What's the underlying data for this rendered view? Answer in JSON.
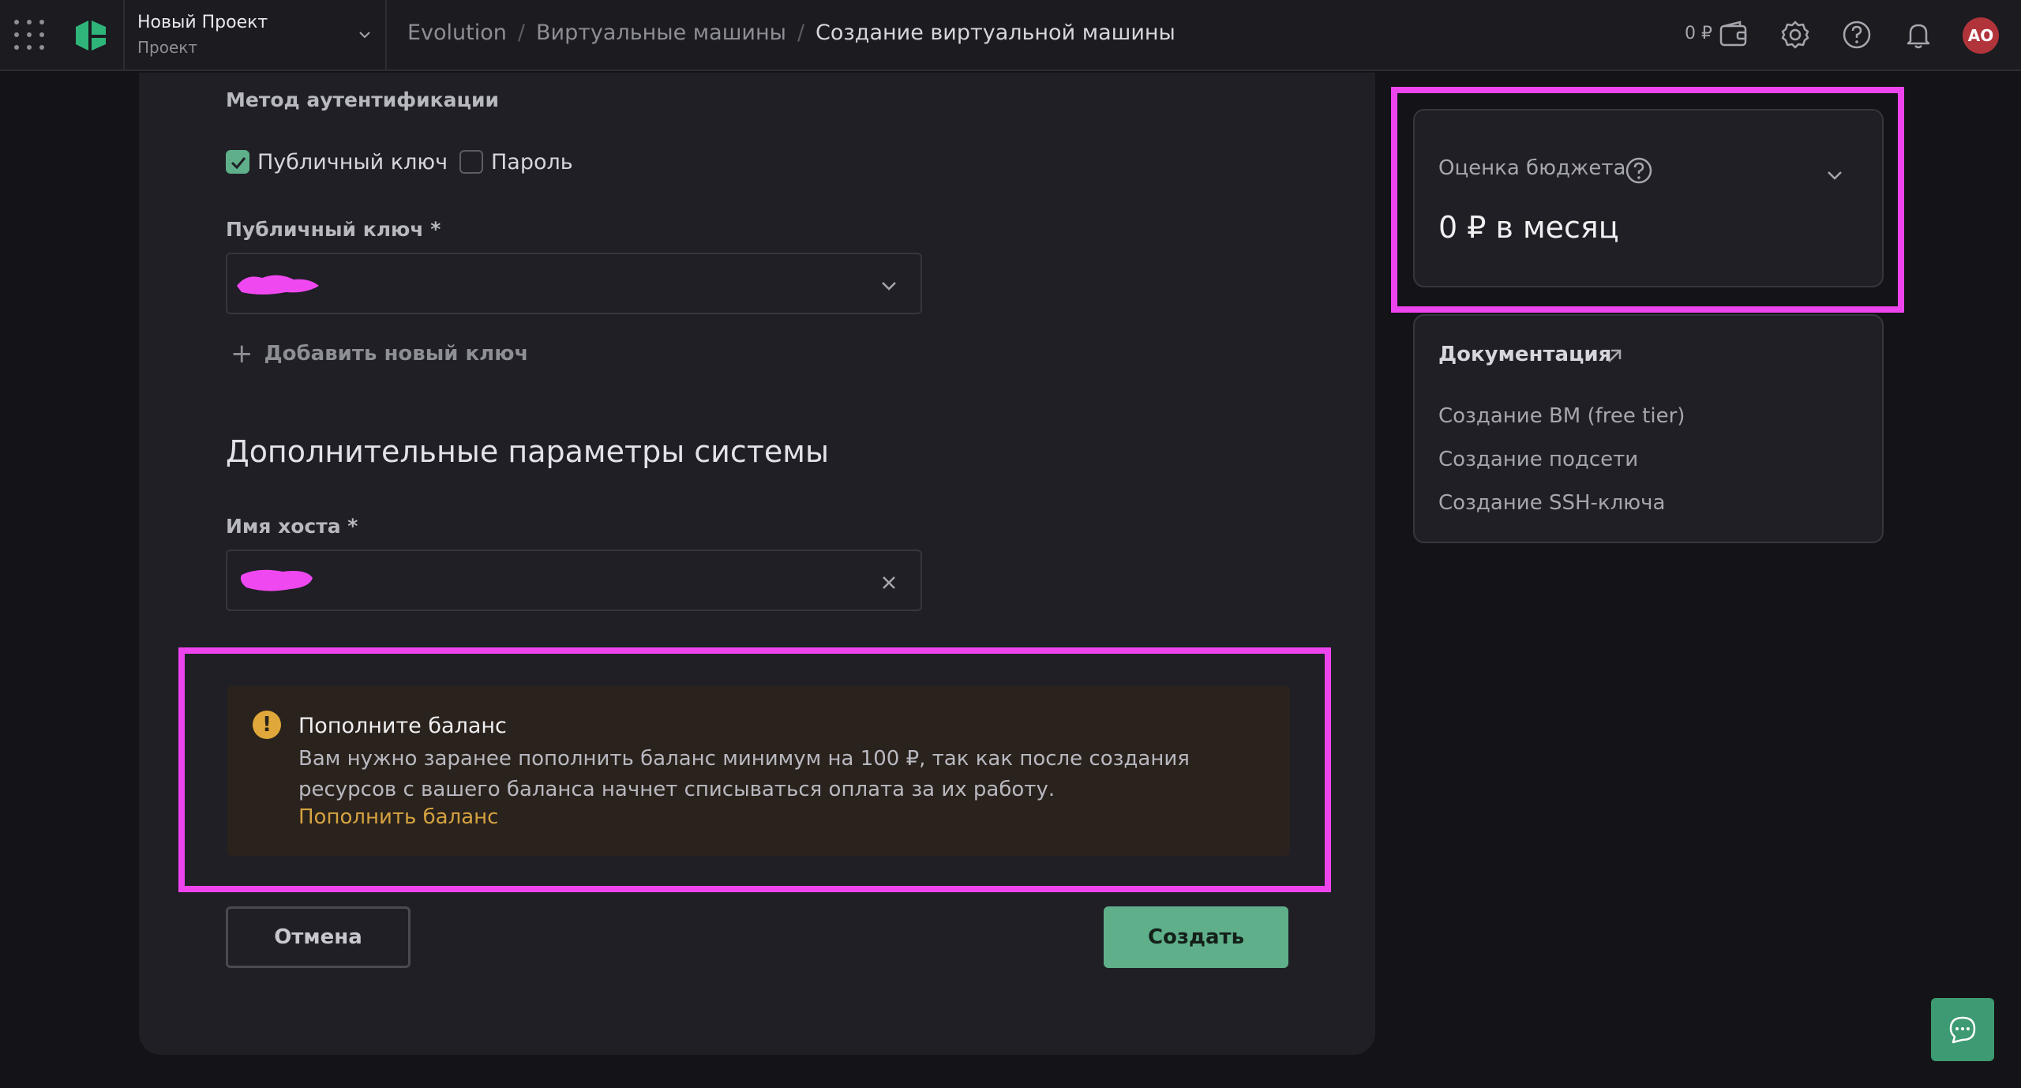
{
  "header": {
    "project": {
      "name": "Новый Проект",
      "subtitle": "Проект"
    },
    "breadcrumbs": [
      {
        "label": "Evolution"
      },
      {
        "label": "Виртуальные машины"
      },
      {
        "label": "Создание виртуальной машины"
      }
    ],
    "balance": "0 ₽",
    "avatar_initials": "АО",
    "icons": [
      "apps-grid-icon",
      "wallet-icon",
      "settings-icon",
      "help-icon",
      "bell-icon"
    ]
  },
  "form": {
    "auth_method_label": "Метод аутентификации",
    "auth_options": [
      {
        "label": "Публичный ключ",
        "checked": true
      },
      {
        "label": "Пароль",
        "checked": false
      }
    ],
    "public_key_label": "Публичный ключ *",
    "add_key_label": "Добавить новый ключ",
    "extra_section_title": "Дополнительные параметры системы",
    "hostname_label": "Имя хоста *",
    "alert": {
      "title": "Пополните баланс",
      "text": "Вам нужно заранее пополнить баланс минимум на 100 ₽, так как после создания ресурсов с вашего баланса начнет списываться оплата за их работу.",
      "link": "Пополнить баланс"
    },
    "cancel_label": "Отмена",
    "create_label": "Создать"
  },
  "budget": {
    "label": "Оценка бюджета",
    "value": "0 ₽ в месяц"
  },
  "docs": {
    "title": "Документация",
    "links": [
      "Создание ВМ (free tier)",
      "Создание подсети",
      "Создание SSH-ключа"
    ]
  },
  "colors": {
    "accent": "#5fb08a",
    "highlight": "#ee44ee",
    "warning": "#e0a83a",
    "avatar": "#b0343a"
  }
}
